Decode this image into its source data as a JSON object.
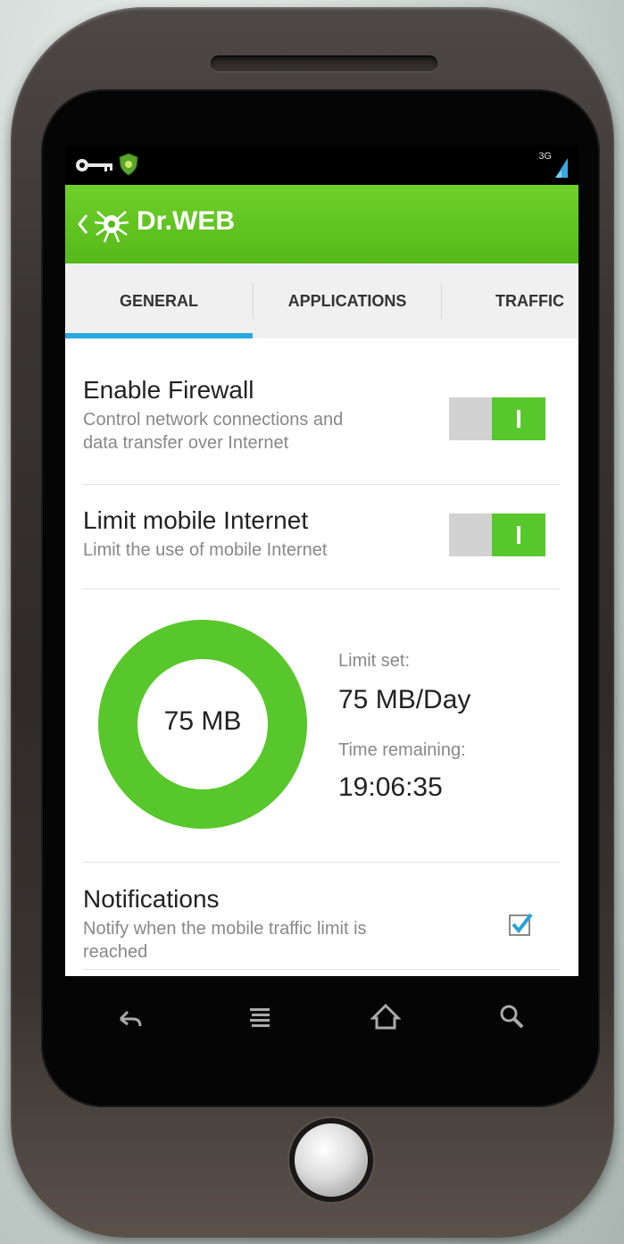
{
  "statusbar": {
    "network": "3G",
    "icons": [
      "key-icon",
      "shield-icon",
      "signal-icon"
    ]
  },
  "appbar": {
    "title": "Dr.WEB",
    "icons": [
      "back-chevron-icon",
      "spider-logo-icon"
    ]
  },
  "tabs": [
    {
      "label": "GENERAL",
      "selected": true
    },
    {
      "label": "APPLICATIONS",
      "selected": false
    },
    {
      "label": "TRAFFIC",
      "selected": false
    }
  ],
  "settings": {
    "firewall": {
      "title": "Enable Firewall",
      "subtitle_line1": "Control network connections and",
      "subtitle_line2": "data transfer over Internet",
      "enabled": true
    },
    "limit": {
      "title": "Limit mobile Internet",
      "subtitle": "Limit the use of mobile Internet",
      "enabled": true
    },
    "usage": {
      "donut_label": "75 MB",
      "limit_set_label": "Limit set:",
      "limit_set_value": "75 MB/Day",
      "time_remaining_label": "Time remaining:",
      "time_remaining_value": "19:06:35"
    },
    "notifications": {
      "title": "Notifications",
      "subtitle_line1": "Notify when the mobile traffic limit is",
      "subtitle_line2": "reached",
      "checked": true
    }
  },
  "navbar": {
    "icons": [
      "back-icon",
      "menu-icon",
      "home-icon",
      "search-icon"
    ]
  },
  "colors": {
    "accent_green": "#58c72b",
    "tab_indicator": "#2aa8e0",
    "appbar_green": "#62c421"
  }
}
